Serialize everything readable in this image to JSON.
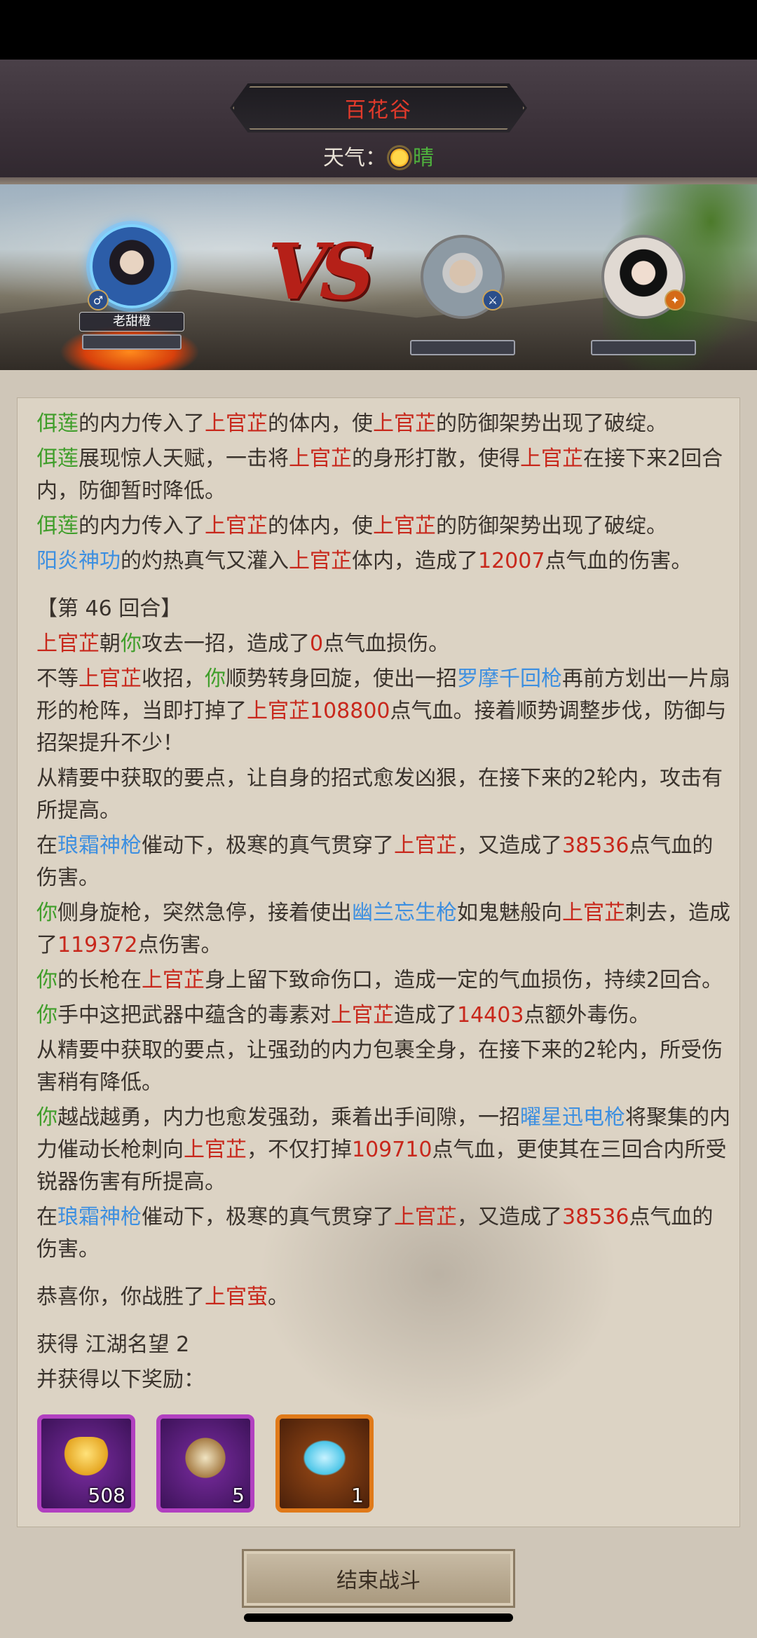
{
  "header": {
    "title": "百花谷",
    "weather_label": "天气：",
    "weather_value": "晴"
  },
  "battle": {
    "vs_text": "VS",
    "player_name": "老甜橙"
  },
  "log": [
    [
      {
        "t": "佴莲",
        "c": "g"
      },
      {
        "t": "的内力传入了"
      },
      {
        "t": "上官芷",
        "c": "r"
      },
      {
        "t": "的体内，使"
      },
      {
        "t": "上官芷",
        "c": "r"
      },
      {
        "t": "的防御架势出现了破绽。"
      }
    ],
    [
      {
        "t": "佴莲",
        "c": "g"
      },
      {
        "t": "展现惊人天赋，一击将"
      },
      {
        "t": "上官芷",
        "c": "r"
      },
      {
        "t": "的身形打散，使得"
      },
      {
        "t": "上官芷",
        "c": "r"
      },
      {
        "t": "在接下来2回合内，防御暂时降低。"
      }
    ],
    [
      {
        "t": "佴莲",
        "c": "g"
      },
      {
        "t": "的内力传入了"
      },
      {
        "t": "上官芷",
        "c": "r"
      },
      {
        "t": "的体内，使"
      },
      {
        "t": "上官芷",
        "c": "r"
      },
      {
        "t": "的防御架势出现了破绽。"
      }
    ],
    [
      {
        "t": "阳炎神功",
        "c": "b"
      },
      {
        "t": "的灼热真气又灌入"
      },
      {
        "t": "上官芷",
        "c": "r"
      },
      {
        "t": "体内，造成了"
      },
      {
        "t": "12007",
        "c": "r"
      },
      {
        "t": "点气血的伤害。"
      }
    ],
    "gap",
    [
      {
        "t": "【第 46 回合】"
      }
    ],
    [
      {
        "t": "上官芷",
        "c": "r"
      },
      {
        "t": "朝"
      },
      {
        "t": "你",
        "c": "g"
      },
      {
        "t": "攻去一招，造成了"
      },
      {
        "t": "0",
        "c": "r"
      },
      {
        "t": "点气血损伤。"
      }
    ],
    [
      {
        "t": "不等"
      },
      {
        "t": "上官芷",
        "c": "r"
      },
      {
        "t": "收招，"
      },
      {
        "t": "你",
        "c": "g"
      },
      {
        "t": "顺势转身回旋，使出一招"
      },
      {
        "t": "罗摩千回枪",
        "c": "b"
      },
      {
        "t": "再前方划出一片扇形的枪阵，当即打掉了"
      },
      {
        "t": "上官芷",
        "c": "r"
      },
      {
        "t": "108800",
        "c": "r"
      },
      {
        "t": "点气血。接着顺势调整步伐，防御与招架提升不少！"
      }
    ],
    [
      {
        "t": "从精要中获取的要点，让自身的招式愈发凶狠，在接下来的2轮内，攻击有所提高。"
      }
    ],
    [
      {
        "t": "在"
      },
      {
        "t": "琅霜神枪",
        "c": "b"
      },
      {
        "t": "催动下，极寒的真气贯穿了"
      },
      {
        "t": "上官芷",
        "c": "r"
      },
      {
        "t": "，又造成了"
      },
      {
        "t": "38536",
        "c": "r"
      },
      {
        "t": "点气血的伤害。"
      }
    ],
    [
      {
        "t": "你",
        "c": "g"
      },
      {
        "t": "侧身旋枪，突然急停，接着使出"
      },
      {
        "t": "幽兰忘生枪",
        "c": "b"
      },
      {
        "t": "如鬼魅般向"
      },
      {
        "t": "上官芷",
        "c": "r"
      },
      {
        "t": "刺去，造成了"
      },
      {
        "t": "119372",
        "c": "r"
      },
      {
        "t": "点伤害。"
      }
    ],
    [
      {
        "t": "你",
        "c": "g"
      },
      {
        "t": "的长枪在"
      },
      {
        "t": "上官芷",
        "c": "r"
      },
      {
        "t": "身上留下致命伤口，造成一定的气血损伤，持续2回合。"
      }
    ],
    [
      {
        "t": "你",
        "c": "g"
      },
      {
        "t": "手中这把武器中蕴含的毒素对"
      },
      {
        "t": "上官芷",
        "c": "r"
      },
      {
        "t": "造成了"
      },
      {
        "t": "14403",
        "c": "r"
      },
      {
        "t": "点额外毒伤。"
      }
    ],
    [
      {
        "t": "从精要中获取的要点，让强劲的内力包裹全身，在接下来的2轮内，所受伤害稍有降低。"
      }
    ],
    [
      {
        "t": "你",
        "c": "g"
      },
      {
        "t": "越战越勇，内力也愈发强劲，乘着出手间隙，一招"
      },
      {
        "t": "曜星迅电枪",
        "c": "b"
      },
      {
        "t": "将聚集的内力催动长枪刺向"
      },
      {
        "t": "上官芷",
        "c": "r"
      },
      {
        "t": "，不仅打掉"
      },
      {
        "t": "109710",
        "c": "r"
      },
      {
        "t": "点气血，更使其在三回合内所受锐器伤害有所提高。"
      }
    ],
    [
      {
        "t": "在"
      },
      {
        "t": "琅霜神枪",
        "c": "b"
      },
      {
        "t": "催动下，极寒的真气贯穿了"
      },
      {
        "t": "上官芷",
        "c": "r"
      },
      {
        "t": "，又造成了"
      },
      {
        "t": "38536",
        "c": "r"
      },
      {
        "t": "点气血的伤害。"
      }
    ],
    "gap",
    [
      {
        "t": "恭喜你，你战胜了"
      },
      {
        "t": "上官萤",
        "c": "r"
      },
      {
        "t": "。"
      }
    ],
    "gap",
    [
      {
        "t": "获得 江湖名望 2"
      }
    ],
    [
      {
        "t": "并获得以下奖励："
      }
    ]
  ],
  "rewards": [
    {
      "icon": "gold-ingot-icon",
      "qty": "508",
      "rarity": "purple"
    },
    {
      "icon": "pouch-icon",
      "qty": "5",
      "rarity": "purple"
    },
    {
      "icon": "cloud-swirl-icon",
      "qty": "1",
      "rarity": "orange"
    }
  ],
  "footer": {
    "end_button": "结束战斗"
  },
  "colors": {
    "green": "#3f9e2a",
    "red": "#c8281c",
    "blue": "#3d8fe0"
  }
}
